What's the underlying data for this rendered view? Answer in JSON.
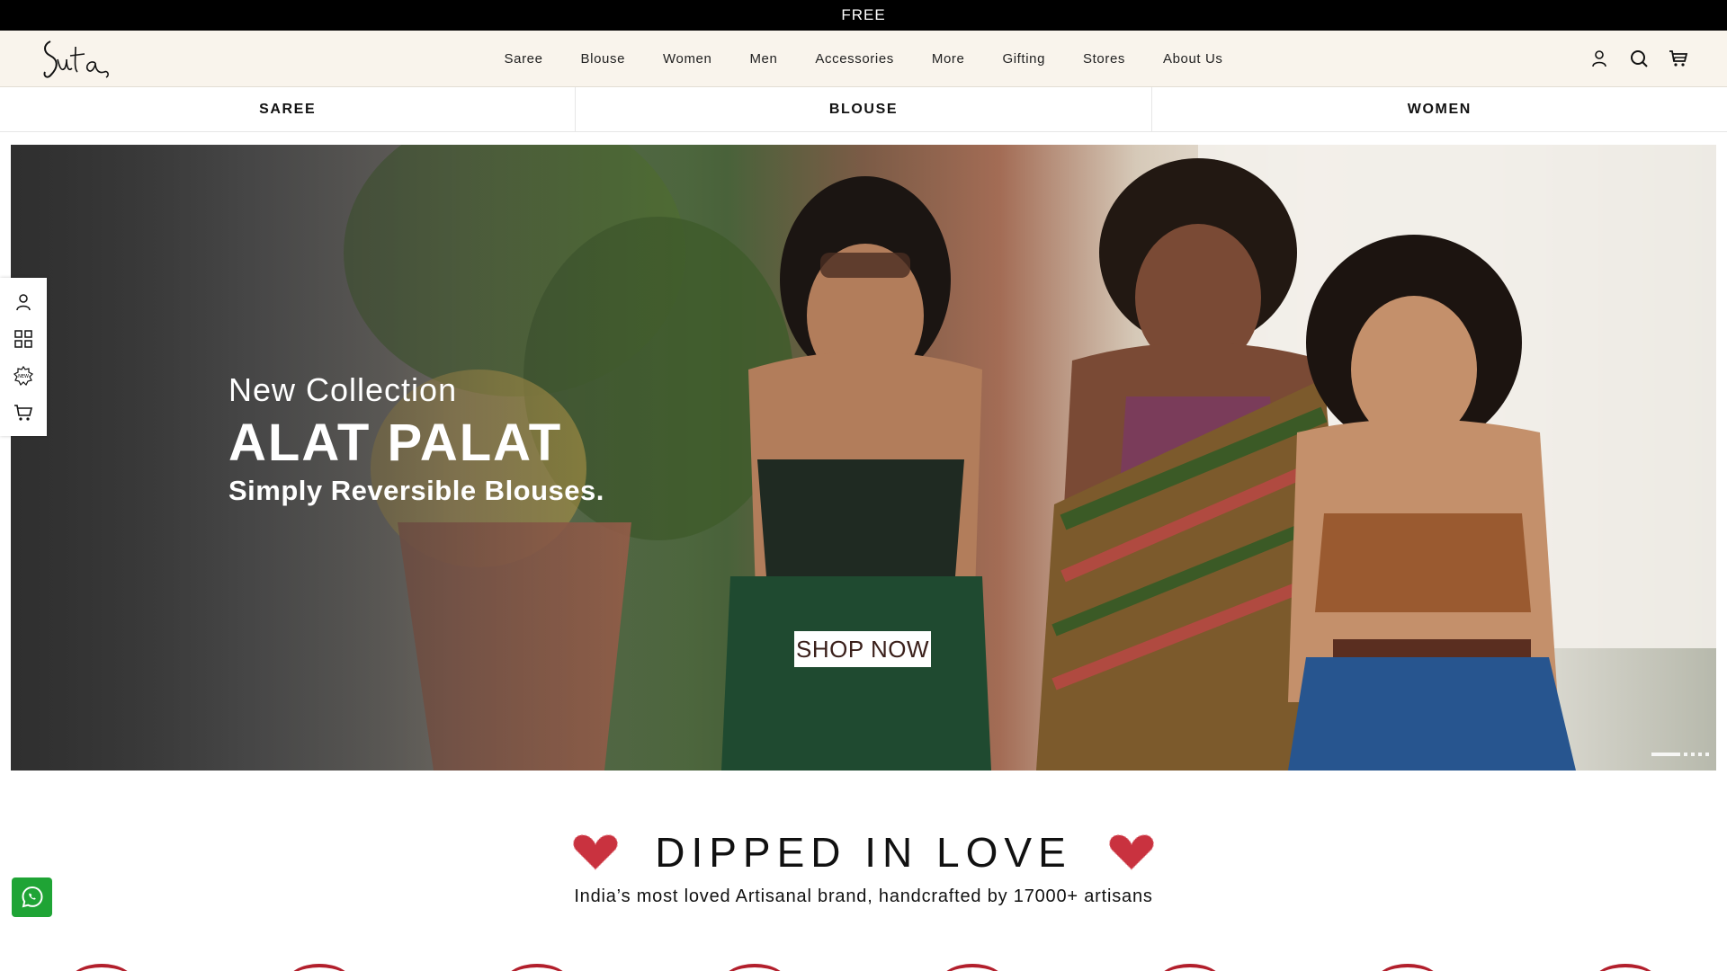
{
  "announcement": {
    "text": "FREE"
  },
  "header": {
    "logo_alt": "Suta",
    "nav": [
      "Saree",
      "Blouse",
      "Women",
      "Men",
      "Accessories",
      "More",
      "Gifting",
      "Stores",
      "About Us"
    ],
    "icons": [
      "account-icon",
      "search-icon",
      "cart-icon"
    ]
  },
  "categories": [
    "SAREE",
    "BLOUSE",
    "WOMEN"
  ],
  "hero": {
    "kicker": "New Collection",
    "title": "ALAT PALAT",
    "subtitle": "Simply Reversible Blouses.",
    "cta": "SHOP NOW",
    "slide_count": 5,
    "active_slide": 1
  },
  "sidebar": {
    "icons": [
      "account-icon",
      "grid-icon",
      "new-badge-icon",
      "cart-icon"
    ]
  },
  "section": {
    "title": "DIPPED IN LOVE",
    "subtitle": "India’s most loved Artisanal brand, handcrafted by 17000+ artisans"
  },
  "colors": {
    "announcement_bg": "#000000",
    "header_bg": "#f9f4ec",
    "whatsapp": "#1fa435",
    "heart": "#c9323f"
  }
}
